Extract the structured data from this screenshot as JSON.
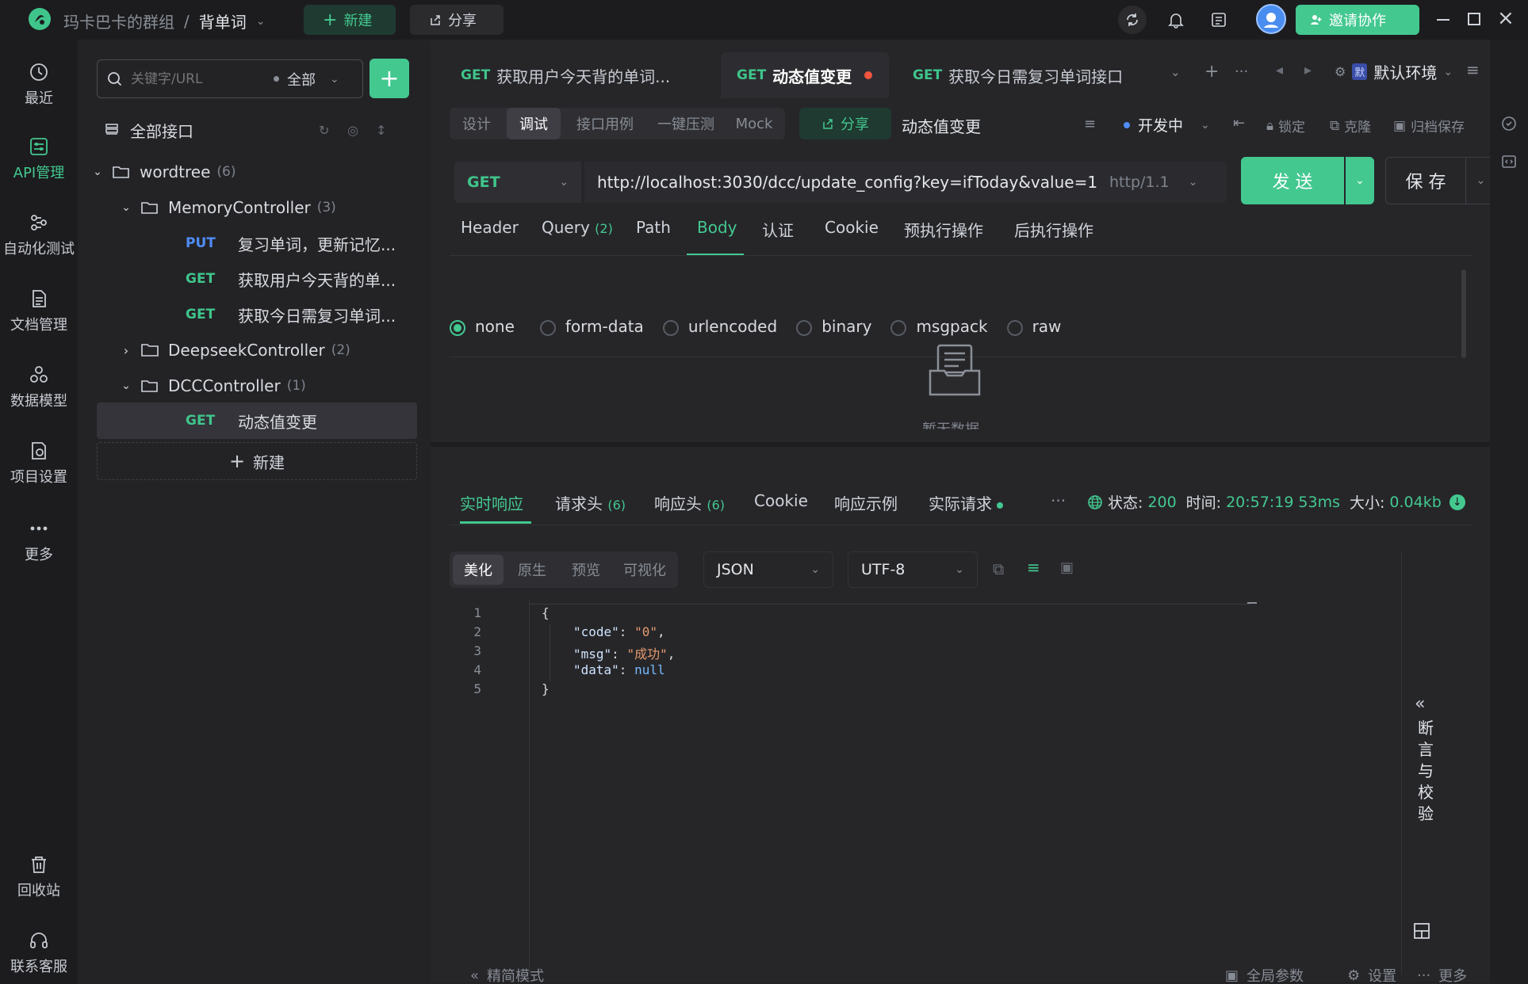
{
  "titlebar": {
    "breadcrumb_team": "玛卡巴卡的群组",
    "breadcrumb_sep": "/",
    "breadcrumb_project": "背单词",
    "new_label": "新建",
    "share_label": "分享",
    "invite_label": "邀请协作"
  },
  "rail": {
    "items": [
      {
        "label": "最近",
        "icon": "clock-icon"
      },
      {
        "label": "API管理",
        "icon": "api-icon"
      },
      {
        "label": "自动化测试",
        "icon": "automation-icon"
      },
      {
        "label": "文档管理",
        "icon": "document-icon"
      },
      {
        "label": "数据模型",
        "icon": "data-model-icon"
      },
      {
        "label": "项目设置",
        "icon": "project-settings-icon"
      },
      {
        "label": "更多",
        "icon": "more-icon"
      }
    ],
    "bottom": [
      {
        "label": "回收站",
        "icon": "trash-icon"
      },
      {
        "label": "联系客服",
        "icon": "headset-icon"
      }
    ]
  },
  "tree": {
    "search_placeholder": "关键字/URL",
    "filter_label": "全部",
    "all_apis": "全部接口",
    "root": {
      "name": "wordtree",
      "count": "(6)"
    },
    "folders": [
      {
        "name": "MemoryController",
        "count": "(3)"
      },
      {
        "name": "DeepseekController",
        "count": "(2)"
      },
      {
        "name": "DCCController",
        "count": "(1)"
      }
    ],
    "apis": [
      {
        "method": "PUT",
        "name": "复习单词，更新记忆..."
      },
      {
        "method": "GET",
        "name": "获取用户今天背的单..."
      },
      {
        "method": "GET",
        "name": "获取今日需复习单词..."
      },
      {
        "method": "GET",
        "name": "动态值变更"
      }
    ],
    "new_label": "新建"
  },
  "tabs": [
    {
      "method": "GET",
      "name": "获取用户今天背的单词..."
    },
    {
      "method": "GET",
      "name": "动态值变更"
    },
    {
      "method": "GET",
      "name": "获取今日需复习单词接口"
    }
  ],
  "env": {
    "badge": "默",
    "label": "默认环境"
  },
  "subtoolbar": {
    "segments": [
      "设计",
      "调试",
      "接口用例",
      "一键压测",
      "Mock"
    ],
    "share_label": "分享",
    "api_name": "动态值变更",
    "status_label": "开发中",
    "lock_label": "锁定",
    "clone_label": "克隆",
    "archive_label": "归档保存"
  },
  "request": {
    "method": "GET",
    "url": "http://localhost:3030/dcc/update_config?key=ifToday&value=1",
    "protocol": "http/1.1",
    "send_label": "发 送",
    "save_label": "保 存",
    "tabs": [
      {
        "label": "Header"
      },
      {
        "label": "Query",
        "count": "(2)"
      },
      {
        "label": "Path"
      },
      {
        "label": "Body"
      },
      {
        "label": "认证"
      },
      {
        "label": "Cookie"
      },
      {
        "label": "预执行操作"
      },
      {
        "label": "后执行操作"
      }
    ],
    "body_types": [
      "none",
      "form-data",
      "urlencoded",
      "binary",
      "msgpack",
      "raw"
    ],
    "empty_text": "暂无数据"
  },
  "response": {
    "tabs": [
      {
        "label": "实时响应"
      },
      {
        "label": "请求头",
        "count": "(6)"
      },
      {
        "label": "响应头",
        "count": "(6)"
      },
      {
        "label": "Cookie"
      },
      {
        "label": "响应示例"
      },
      {
        "label": "实际请求"
      }
    ],
    "more": "···",
    "status_label": "状态:",
    "status_value": "200",
    "time_label": "时间:",
    "time_value": "20:57:19",
    "duration": "53ms",
    "size_label": "大小:",
    "size_value": "0.04kb",
    "view_modes": [
      "美化",
      "原生",
      "预览",
      "可视化"
    ],
    "format": "JSON",
    "encoding": "UTF-8",
    "line_numbers": [
      "1",
      "2",
      "3",
      "4",
      "5"
    ],
    "code": {
      "open": "{",
      "k1": "\"code\"",
      "v1": "\"0\"",
      "k2": "\"msg\"",
      "v2": "\"成功\"",
      "k3": "\"data\"",
      "v3": "null",
      "close": "}"
    },
    "assert_panel": "断言与校验"
  },
  "footer": {
    "compact_mode": "精简模式",
    "global_params": "全局参数",
    "settings": "设置",
    "more": "更多"
  },
  "colors": {
    "accent": "#43c890",
    "get": "#3fc58b",
    "put": "#4f8cf5",
    "error_dot": "#f0553f"
  }
}
